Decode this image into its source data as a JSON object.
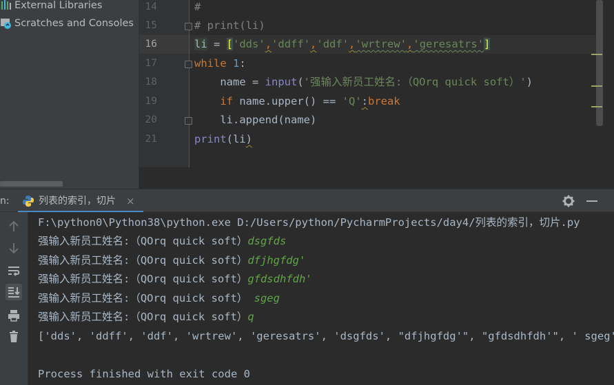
{
  "project_tree": {
    "items": [
      {
        "label": "External Libraries",
        "icon": "library-icon"
      },
      {
        "label": "Scratches and Consoles",
        "icon": "scratches-icon"
      }
    ]
  },
  "editor": {
    "lines": [
      {
        "no": "14",
        "code": "#"
      },
      {
        "no": "15",
        "code": "# print(li)"
      },
      {
        "no": "16",
        "code": "li = ['dds','ddff','ddf','wrtrew','geresatrs']"
      },
      {
        "no": "17",
        "code": "while 1:"
      },
      {
        "no": "18",
        "code": "    name = input('强输入新员工姓名:（QOrq quick soft）')"
      },
      {
        "no": "19",
        "code": "    if name.upper() == 'Q':break"
      },
      {
        "no": "20",
        "code": "    li.append(name)"
      },
      {
        "no": "21",
        "code": "print(li)"
      }
    ],
    "tokens": {
      "l14": "#",
      "l15": "# print(li)",
      "l16": {
        "var": "li",
        "eq": " = ",
        "open": "[",
        "s1": "'dds'",
        "c1": ",",
        "s2": "'ddff'",
        "c2": ",",
        "s3": "'ddf'",
        "c3": ",",
        "s4": "'wrtrew'",
        "c4": ",",
        "s5": "'geresatrs'",
        "close": "]"
      },
      "l17": {
        "kw": "while",
        "sp": " ",
        "num": "1",
        "colon": ":"
      },
      "l18": {
        "indent": "    ",
        "lhs": "name = ",
        "fn": "input",
        "open": "(",
        "str": "'强输入新员工姓名:（QOrq quick soft）'",
        "close": ")"
      },
      "l19": {
        "indent": "    ",
        "kw": "if",
        "mid": " name.upper() == ",
        "str": "'Q'",
        "colon": ":",
        "kw2": "break"
      },
      "l20": {
        "indent": "    ",
        "text": "li.append(name)"
      },
      "l21": {
        "fn": "print",
        "rest": "(li",
        "close": ")"
      }
    },
    "current_line": "16"
  },
  "run_window": {
    "header_label": "n:",
    "tab_label": "列表的索引，切片",
    "tab_close": "×",
    "console": {
      "command": "F:\\python0\\Python38\\python.exe D:/Users/python/PycharmProjects/day4/列表的索引，切片.py",
      "prompts": [
        {
          "prompt": "强输入新员工姓名:（QOrq quick soft）",
          "input": "dsgfds"
        },
        {
          "prompt": "强输入新员工姓名:（QOrq quick soft）",
          "input": "dfjhgfdg'"
        },
        {
          "prompt": "强输入新员工姓名:（QOrq quick soft）",
          "input": "gfdsdhfdh'"
        },
        {
          "prompt": "强输入新员工姓名:（QOrq quick soft）",
          "input": " sgeg"
        },
        {
          "prompt": "强输入新员工姓名:（QOrq quick soft）",
          "input": "q"
        }
      ],
      "result": "['dds', 'ddff', 'ddf', 'wrtrew', 'geresatrs', 'dsgfds', \"dfjhgfdg'\", \"gfdsdhfdh'\", ' sgeg']",
      "exit": "Process finished with exit code 0"
    },
    "toolbar_icons": [
      "arrow-up-icon",
      "arrow-down-icon",
      "soft-wrap-icon",
      "scroll-to-end-icon",
      "print-icon",
      "trash-icon"
    ]
  },
  "colors": {
    "keyword": "#cc7832",
    "string": "#6a8759",
    "number": "#6897bb",
    "builtin": "#8888c6",
    "comment": "#808080",
    "console_input": "#62a548",
    "accent": "#4a88c7"
  }
}
